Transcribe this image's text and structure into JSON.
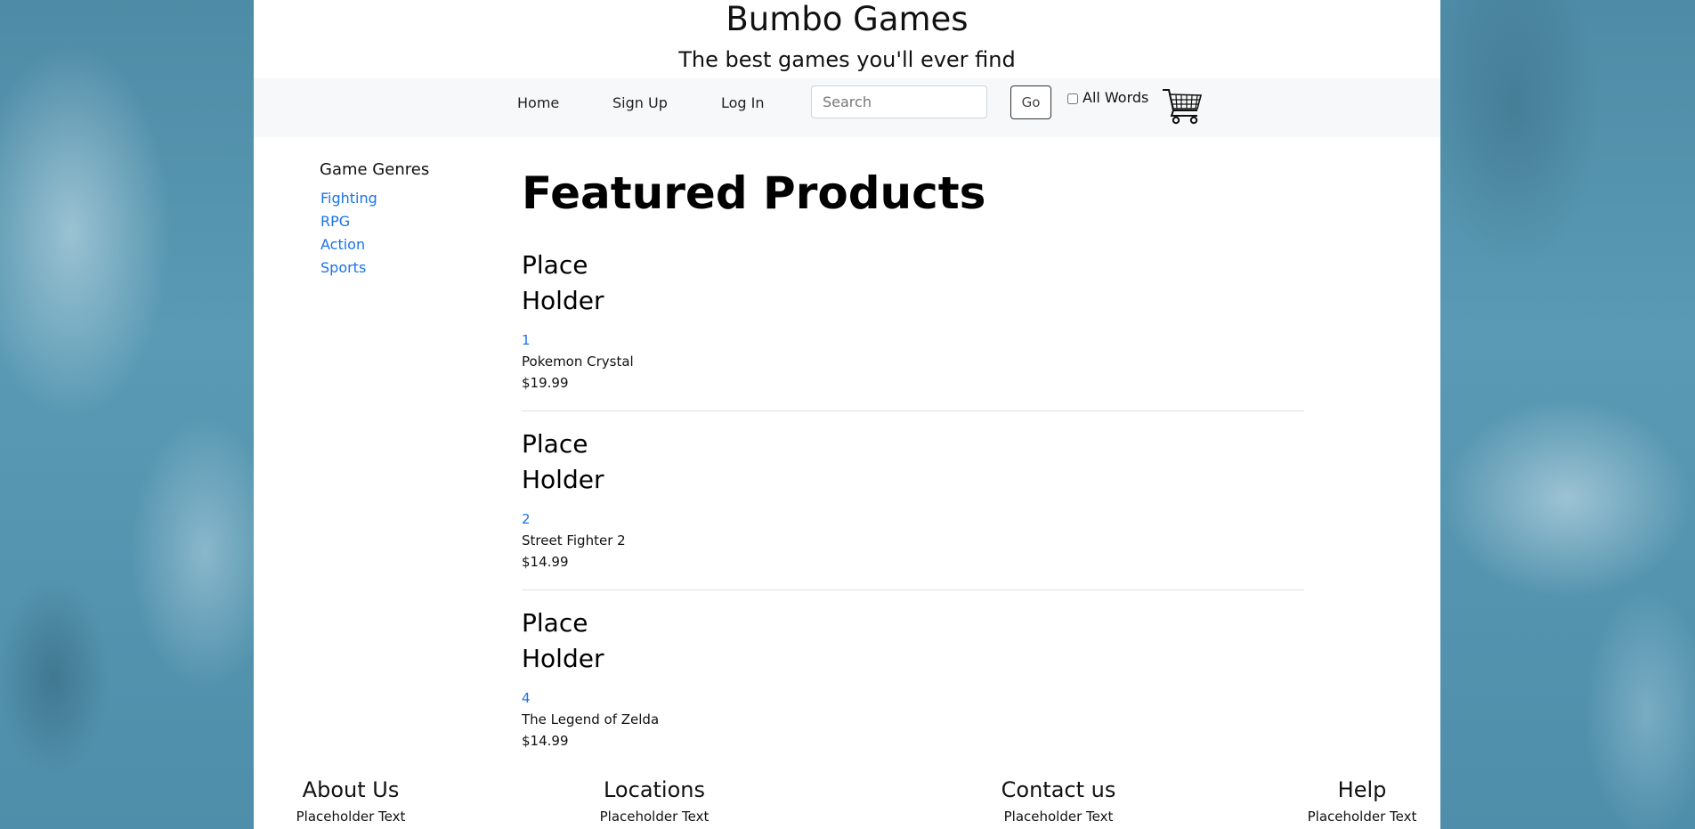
{
  "site": {
    "title": "Bumbo Games",
    "tagline": "The best games you'll ever find"
  },
  "nav": {
    "home": "Home",
    "signup": "Sign Up",
    "login": "Log In",
    "search_placeholder": "Search",
    "go_label": "Go",
    "all_words_label": "All Words",
    "cart_icon": "shopping-cart-icon"
  },
  "sidebar": {
    "title": "Game Genres",
    "genres": [
      "Fighting",
      "RPG",
      "Action",
      "Sports"
    ]
  },
  "main": {
    "heading": "Featured Products",
    "products": [
      {
        "image_text": "Place Holder",
        "id": "1",
        "name": "Pokemon Crystal",
        "price": "$19.99"
      },
      {
        "image_text": "Place Holder",
        "id": "2",
        "name": "Street Fighter 2",
        "price": "$14.99"
      },
      {
        "image_text": "Place Holder",
        "id": "4",
        "name": "The Legend of Zelda",
        "price": "$14.99"
      }
    ]
  },
  "footer": {
    "columns": [
      {
        "heading": "About Us",
        "text": "Placeholder Text"
      },
      {
        "heading": "Locations",
        "text": "Placeholder Text"
      },
      {
        "heading": "Contact us",
        "text": "Placeholder Text"
      },
      {
        "heading": "Help",
        "text": "Placeholder Text"
      }
    ]
  },
  "colors": {
    "link": "#1a73e8",
    "background": "#4f8ea8",
    "navbar": "#f7f8f9"
  }
}
